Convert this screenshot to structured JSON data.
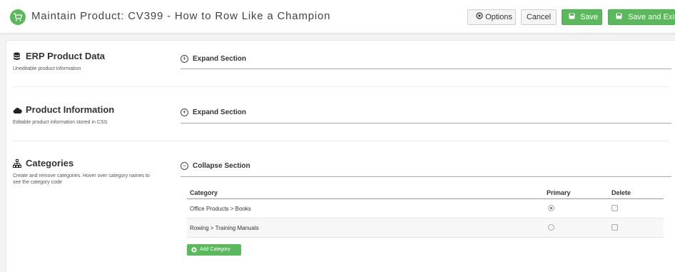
{
  "header": {
    "title": "Maintain Product: CV399 - How to Row Like a Champion",
    "options_label": "Options",
    "cancel_label": "Cancel",
    "save_label": "Save",
    "save_exit_label": "Save and Exit"
  },
  "sections": [
    {
      "icon": "database-icon",
      "title": "ERP Product Data",
      "description": "Uneditable product information",
      "toggle_label": "Expand Section",
      "expanded": false
    },
    {
      "icon": "cloud-icon",
      "title": "Product Information",
      "description": "Editable product information stored in CSS",
      "toggle_label": "Expand Section",
      "expanded": false
    },
    {
      "icon": "sitemap-icon",
      "title": "Categories",
      "description": "Create and remove categories. Hover over category names to see the category code",
      "toggle_label": "Collapse Section",
      "expanded": true
    }
  ],
  "categories_table": {
    "columns": [
      "Category",
      "Primary",
      "Delete"
    ],
    "rows": [
      {
        "category": "Office Products > Books",
        "primary": true,
        "delete": false
      },
      {
        "category": "Rowing > Training Manuals",
        "primary": false,
        "delete": false
      }
    ],
    "add_label": "Add Category"
  },
  "colors": {
    "success": "#5cb85c",
    "header_bg": "#ffffff",
    "page_bg": "#f3f3f3"
  }
}
